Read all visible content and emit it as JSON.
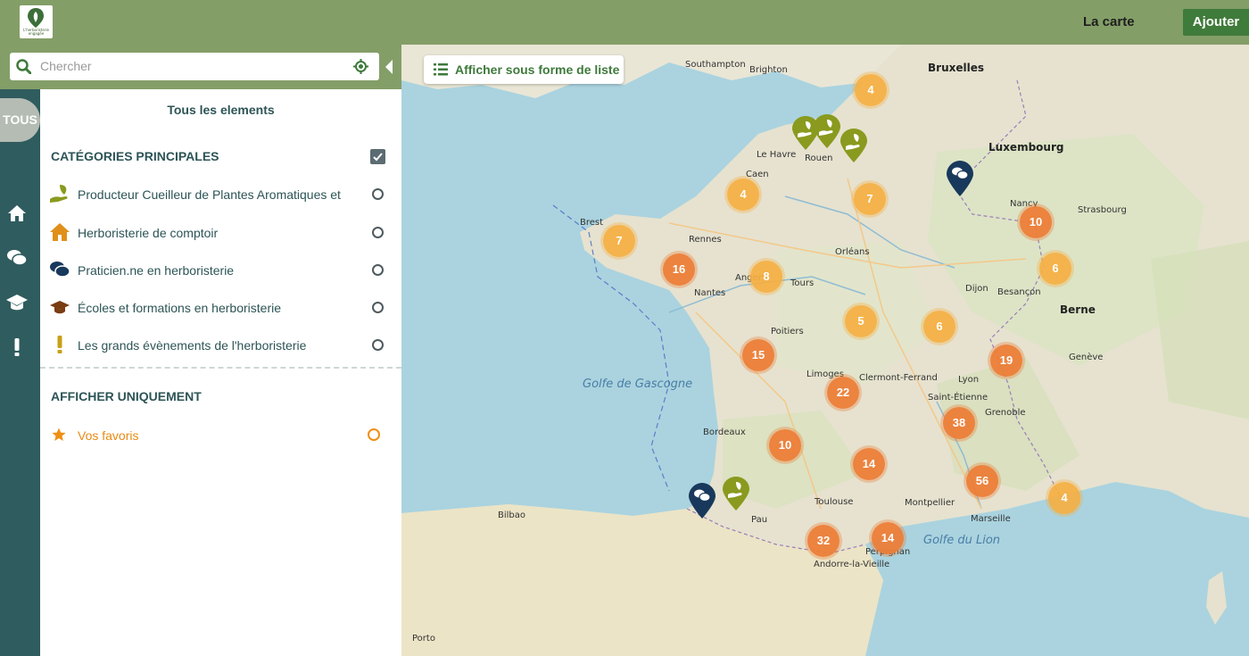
{
  "header": {
    "logo_text": "L'herboristerie engagée",
    "title": "La carte",
    "add_label": "Ajouter"
  },
  "search": {
    "placeholder": "Chercher"
  },
  "sidebar": {
    "tous_label": "TOUS",
    "icons": [
      "home-icon",
      "chat-icon",
      "graduation-cap-icon",
      "exclamation-icon"
    ]
  },
  "panel": {
    "title": "Tous les elements",
    "main_categories_title": "CATÉGORIES PRINCIPALES",
    "categories": [
      {
        "label": "Producteur Cueilleur de Plantes Aromatiques et",
        "icon": "hand-leaf-icon",
        "color": "#8a9a1e"
      },
      {
        "label": "Herboristerie de comptoir",
        "icon": "house-icon",
        "color": "#e0901a"
      },
      {
        "label": "Praticien.ne en herboristerie",
        "icon": "chat-bubbles-icon",
        "color": "#18395c"
      },
      {
        "label": "Écoles et formations en herboristerie",
        "icon": "graduation-cap-icon",
        "color": "#7a3d12"
      },
      {
        "label": "Les grands évènements de l'herboristerie",
        "icon": "exclamation-icon",
        "color": "#c9a014"
      }
    ],
    "show_only_title": "AFFICHER UNIQUEMENT",
    "favorites_label": "Vos favoris"
  },
  "map": {
    "list_button_label": "Afficher sous forme de liste",
    "clusters": [
      "4",
      "4",
      "7",
      "7",
      "16",
      "8",
      "10",
      "6",
      "5",
      "6",
      "15",
      "19",
      "22",
      "38",
      "10",
      "14",
      "56",
      "4",
      "32",
      "14"
    ],
    "cities": [
      "Bruxelles",
      "Luxembourg",
      "Berne",
      "Andorre-la-Vieille",
      "Southampton",
      "Brighton",
      "Le Havre",
      "Rouen",
      "Caen",
      "Brest",
      "Rennes",
      "Nantes",
      "Angers",
      "Tours",
      "Orléans",
      "Poitiers",
      "Limoges",
      "Bordeaux",
      "Toulouse",
      "Lyon",
      "Grenoble",
      "Marseille",
      "Montpellier",
      "Nancy",
      "Strasbourg",
      "Dijon",
      "Besançon",
      "Genève",
      "Clermont-Ferrand",
      "Saint-Étienne",
      "Perpignan",
      "Pau",
      "Bilbao",
      "Porto"
    ],
    "sea_labels": [
      "Golfe de Gascogne",
      "Golfe du Lion"
    ],
    "accent_colors": {
      "cluster_light": "#f5af41",
      "cluster_dark": "#ec7d37"
    }
  }
}
